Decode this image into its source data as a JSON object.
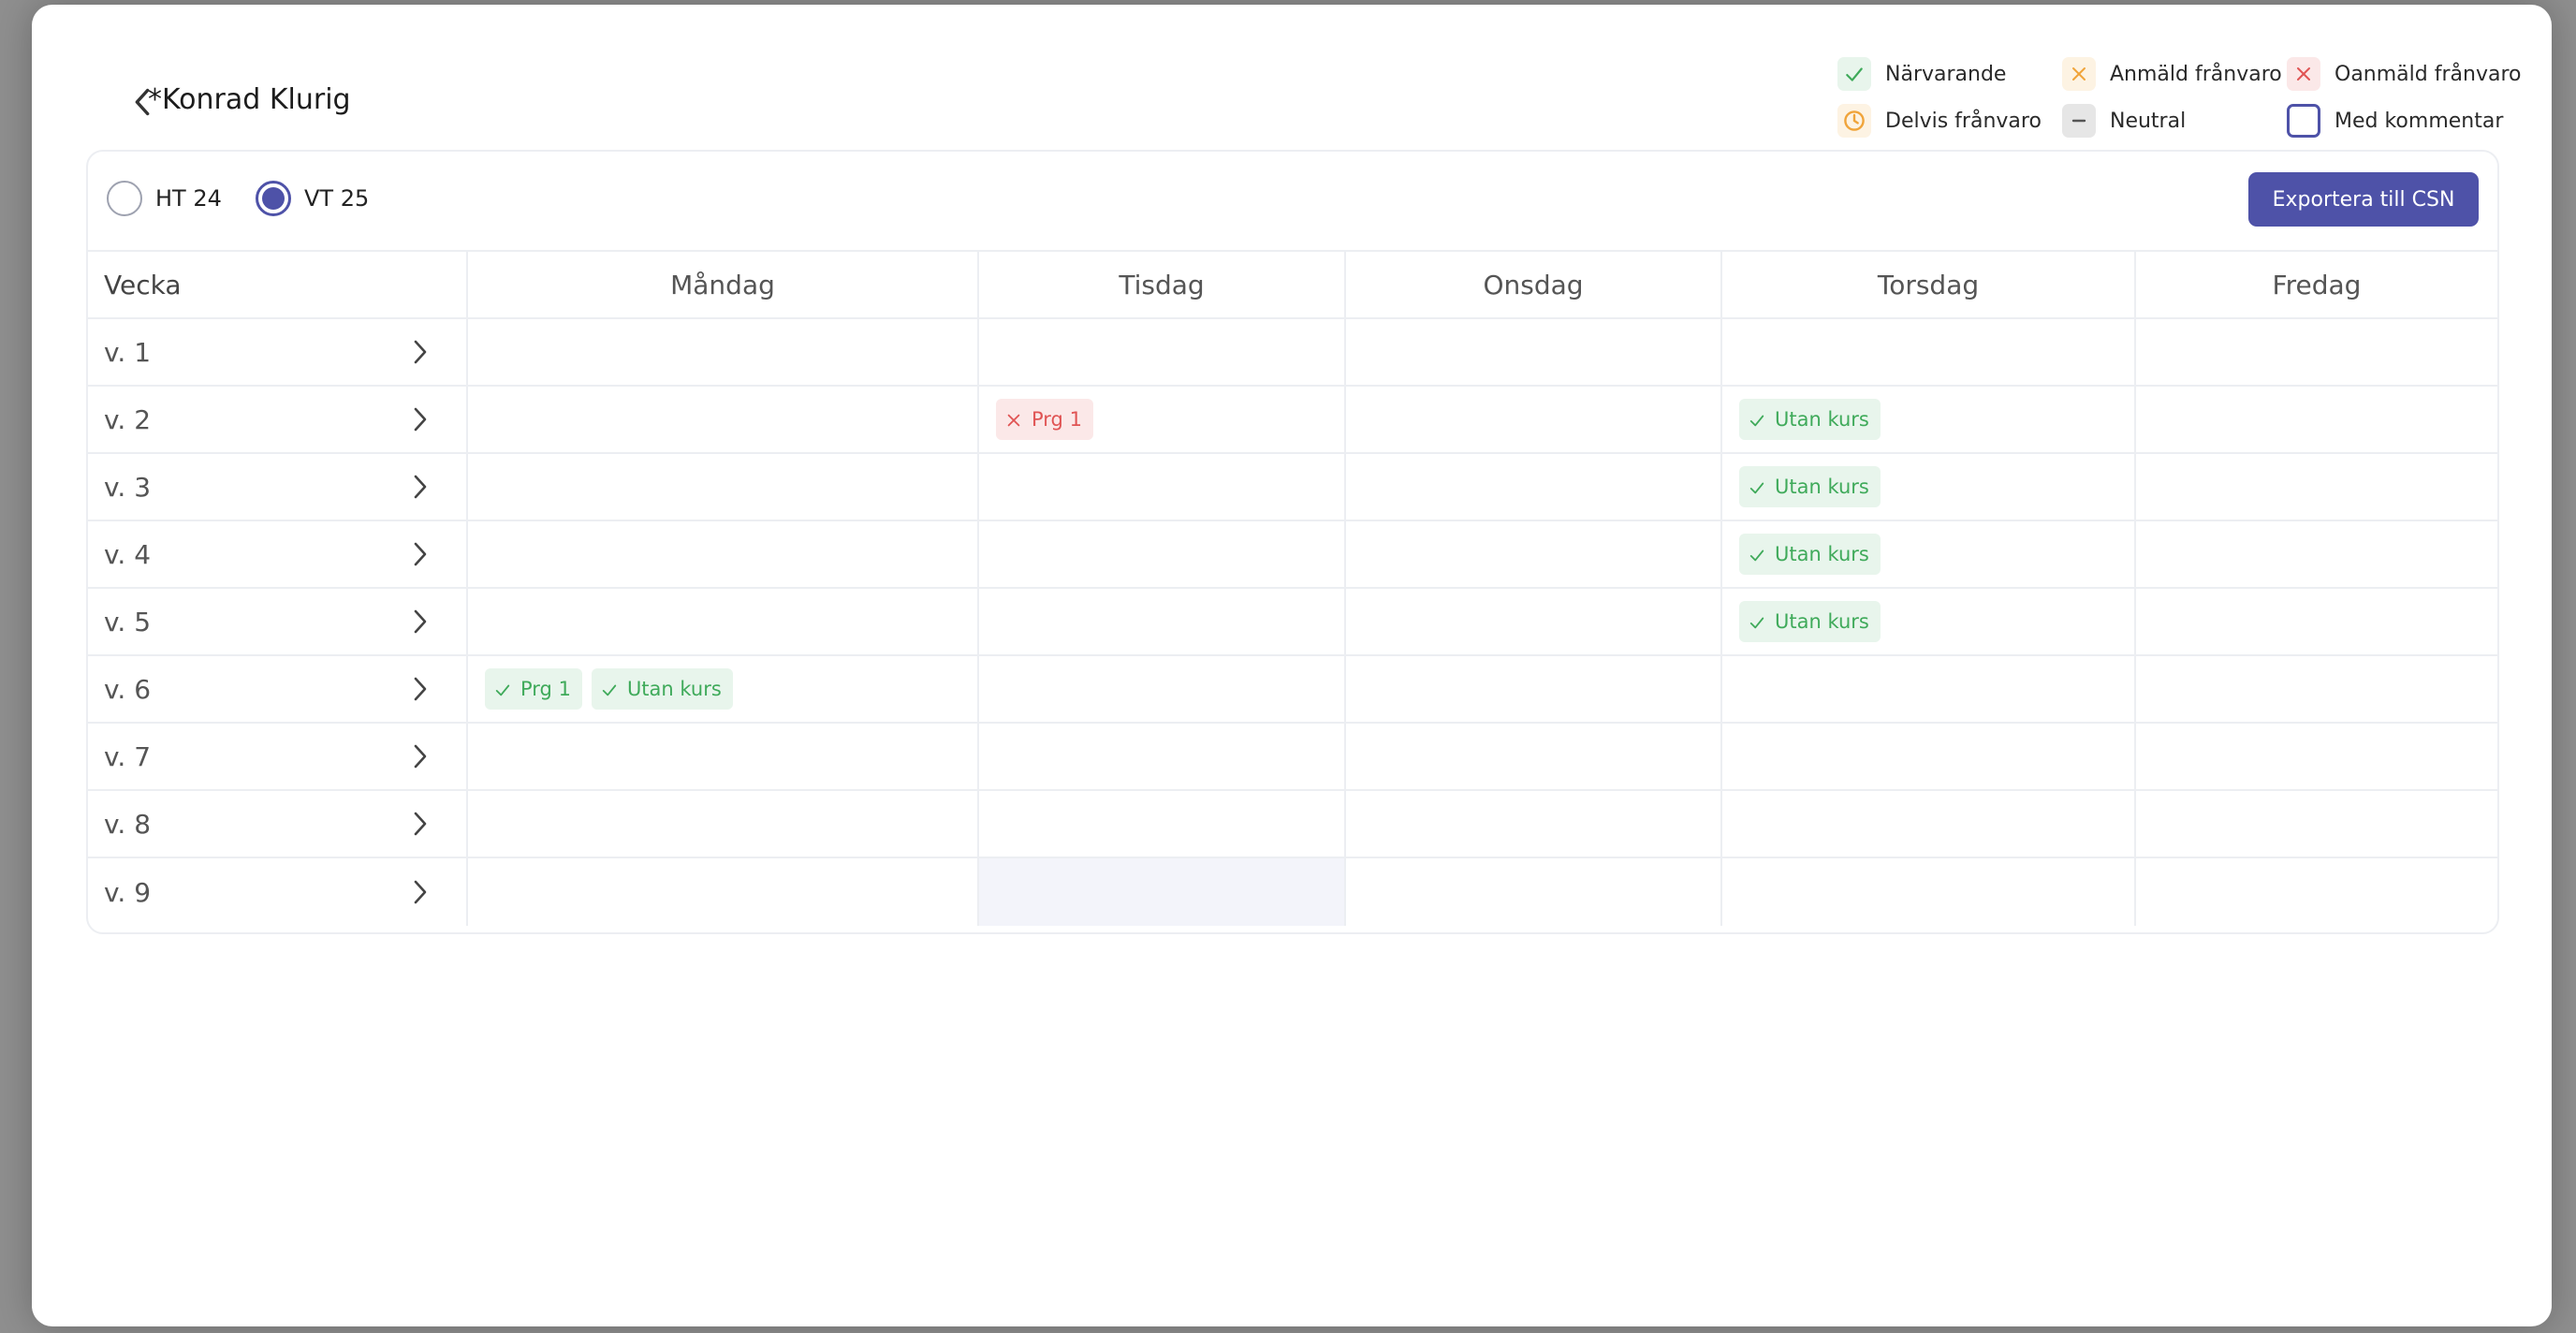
{
  "student": {
    "name": "*Konrad Klurig"
  },
  "legend": [
    {
      "key": "present",
      "label": "Närvarande",
      "icon": "check-icon",
      "bg": "#e8f5ec",
      "fg": "#3faa5a"
    },
    {
      "key": "reported",
      "label": "Anmäld frånvaro",
      "icon": "cross-icon",
      "bg": "#fdf3e3",
      "fg": "#f0a43a"
    },
    {
      "key": "unreported",
      "label": "Oanmäld frånvaro",
      "icon": "cross-icon",
      "bg": "#fbe8e8",
      "fg": "#e05454"
    },
    {
      "key": "partial",
      "label": "Delvis frånvaro",
      "icon": "clock-icon",
      "bg": "#fdf3e3",
      "fg": "#f0a43a"
    },
    {
      "key": "neutral",
      "label": "Neutral",
      "icon": "dash-icon",
      "bg": "#e6e6e6",
      "fg": "#555555"
    },
    {
      "key": "comment",
      "label": "Med kommentar",
      "icon": "outlined-box-icon",
      "bg": "#ffffff",
      "fg": "#4e52a8"
    }
  ],
  "terms": [
    {
      "label": "HT 24",
      "checked": false
    },
    {
      "label": "VT 25",
      "checked": true
    }
  ],
  "export_label": "Exportera till CSN",
  "table": {
    "headers": [
      "Vecka",
      "Måndag",
      "Tisdag",
      "Onsdag",
      "Torsdag",
      "Fredag"
    ],
    "rows": [
      {
        "week": "v. 1",
        "days": [
          [],
          [],
          [],
          [],
          []
        ]
      },
      {
        "week": "v. 2",
        "days": [
          [],
          [
            {
              "label": "Prg 1",
              "status": "absent"
            }
          ],
          [],
          [
            {
              "label": "Utan kurs",
              "status": "present"
            }
          ],
          []
        ]
      },
      {
        "week": "v. 3",
        "days": [
          [],
          [],
          [],
          [
            {
              "label": "Utan kurs",
              "status": "present"
            }
          ],
          []
        ]
      },
      {
        "week": "v. 4",
        "days": [
          [],
          [],
          [],
          [
            {
              "label": "Utan kurs",
              "status": "present"
            }
          ],
          []
        ]
      },
      {
        "week": "v. 5",
        "days": [
          [],
          [],
          [],
          [
            {
              "label": "Utan kurs",
              "status": "present"
            }
          ],
          []
        ]
      },
      {
        "week": "v. 6",
        "days": [
          [
            {
              "label": "Prg 1",
              "status": "present"
            },
            {
              "label": "Utan kurs",
              "status": "present"
            }
          ],
          [],
          [],
          [],
          []
        ]
      },
      {
        "week": "v. 7",
        "days": [
          [],
          [],
          [],
          [],
          []
        ]
      },
      {
        "week": "v. 8",
        "days": [
          [],
          [],
          [],
          [],
          []
        ]
      },
      {
        "week": "v. 9",
        "days": [
          [],
          [],
          [],
          [],
          []
        ],
        "highlight_day": 1
      }
    ]
  }
}
